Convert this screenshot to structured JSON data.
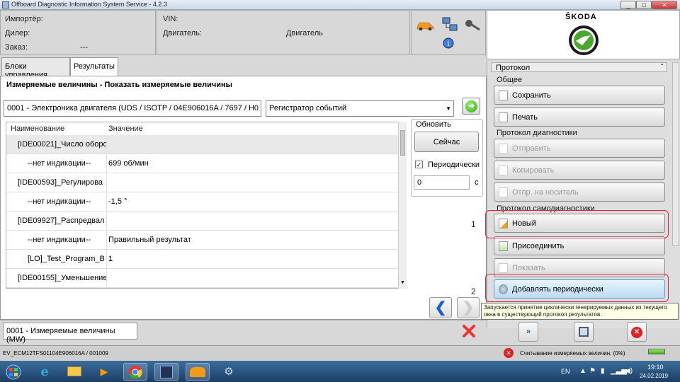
{
  "window": {
    "title": "Offboard Diagnostic Information System Service - 4.2.3",
    "minimize": "_",
    "maximize": "□",
    "close": "✕"
  },
  "header": {
    "importer_label": "Импортёр:",
    "dealer_label": "Дилер:",
    "order_label": "Заказ:",
    "order_value": "---",
    "vin_label": "VIN:",
    "engine_label": "Двигатель:",
    "engine_value": "Двигатель",
    "brand": "ŠKODA"
  },
  "tabs": [
    "Блоки управления",
    "Результаты"
  ],
  "main": {
    "section_title": "Измеряемые величины - Показать измеряемые величины",
    "ecu_select": "0001 - Электроника двигателя  (UDS / ISOTP / 04E906016A / 7697 / H0",
    "recorder_select": "Регистратор событий",
    "columns": [
      "Наименование",
      "Значение"
    ],
    "rows": [
      {
        "name": "[IDE00021]_Число оборо",
        "value": "",
        "indent": 0
      },
      {
        "name": "--нет индикации--",
        "value": "699 об/мин",
        "indent": 1
      },
      {
        "name": "[IDE00593]_Регулирова",
        "value": "",
        "indent": 0
      },
      {
        "name": "--нет индикации--",
        "value": "-1,5 °",
        "indent": 1
      },
      {
        "name": "[IDE09927]_Распредвал",
        "value": "",
        "indent": 0
      },
      {
        "name": "--нет индикации--",
        "value": "Правильный результат",
        "indent": 1
      },
      {
        "name": "[LO]_Test_Program_B",
        "value": "1",
        "indent": 1
      },
      {
        "name": "[IDE00155]_Уменьшение",
        "value": "",
        "indent": 0
      }
    ],
    "refresh": {
      "title": "Обновить",
      "now_button": "Сейчас",
      "periodic_label": "Периодически",
      "periodic_checked": true,
      "interval_value": "0",
      "interval_unit": "с"
    }
  },
  "bottom": {
    "field": "0001 - Измеряемые величины (MW)"
  },
  "sidebar": {
    "title": "Протокол",
    "groups": [
      {
        "label": "Общее"
      },
      {
        "label": "Протокол диагностики"
      },
      {
        "label": "Протокол самодиагностики"
      }
    ],
    "buttons": {
      "save": "Сохранить",
      "print": "Печать",
      "send": "Отправить",
      "copy": "Копировать",
      "export": "Отпр. на носитель",
      "new": "Новый",
      "attach": "Присоединить",
      "show": "Показать",
      "add_periodic": "Добавлять периодически"
    },
    "annotations": [
      "1",
      "2"
    ]
  },
  "tooltip": "Запускается принятие циклически генерируемых данных из текущего окна в существующий протокол результатов.",
  "status": {
    "left": "EV_ECM12TFS01104E906016A / 001009",
    "message": "Считывание измеряемых величин. (0%)"
  },
  "taskbar": {
    "lang": "EN",
    "time": "19:10",
    "date": "24.02.2019"
  },
  "colors": {
    "accent": "#3a6d9c",
    "skoda_green": "#4ba82e",
    "highlight_red": "#d22233"
  }
}
